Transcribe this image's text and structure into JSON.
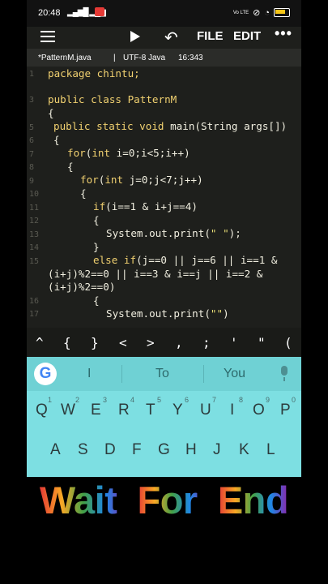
{
  "status": {
    "time": "20:48",
    "net_label": "Vo LTE"
  },
  "toolbar": {
    "file_label": "FILE",
    "edit_label": "EDIT",
    "more": "•••"
  },
  "tab": {
    "filename": "*PatternM.java",
    "sep1": "|",
    "encoding": "UTF-8",
    "language": "Java",
    "cursor": "16:343"
  },
  "editor": {
    "line_numbers": [
      "1",
      "3",
      "5",
      "6",
      "7",
      "8",
      "9",
      "10",
      "11",
      "12",
      "13",
      "14",
      "15",
      "16",
      "17"
    ],
    "lines": {
      "l1": "package chintu;",
      "l3a": "public",
      "l3b": " class PatternM",
      "l4": "{",
      "l5a": "public",
      "l5b": " static",
      "l5c": " void",
      "l5d": " main(String args[])",
      "l6": "{",
      "l7a": "for",
      "l7b": "(",
      "l7c": "int",
      "l7d": " i=0;i<5;i++)",
      "l8": "{",
      "l9a": "for",
      "l9b": "(",
      "l9c": "int",
      "l9d": " j=0;j<7;j++)",
      "l10": "{",
      "l11a": "if",
      "l11b": "(i==1 & i+j==4)",
      "l12": "{",
      "l13a": "System.out.print(",
      "l13b": "\" \"",
      "l13c": ");",
      "l14": "}",
      "l15a": "else if",
      "l15b": "(j==0 || j==6 || i==1 &",
      "l15w1": "(i+j)%2==0 || i==3 & i==j || i==2 &",
      "l15w2": "(i+j)%2==0)",
      "l16": "{",
      "l17a": "System.out.print(",
      "l17b": "\"\"",
      "l17c": ")"
    }
  },
  "symbols": [
    "^",
    "{",
    "}",
    "<",
    ">",
    ",",
    ";",
    "'",
    "\"",
    "("
  ],
  "suggestions": {
    "left": "I",
    "middle": "To",
    "right": "You"
  },
  "keyboard": {
    "row1": [
      "Q",
      "W",
      "E",
      "R",
      "T",
      "Y",
      "U",
      "I",
      "O",
      "P"
    ],
    "row1_hints": [
      "1",
      "2",
      "3",
      "4",
      "5",
      "6",
      "7",
      "8",
      "9",
      "0"
    ],
    "row2": [
      "A",
      "S",
      "D",
      "F",
      "G",
      "H",
      "J",
      "K",
      "L"
    ]
  },
  "banner": {
    "text_parts": [
      "Wait ",
      "For ",
      "End"
    ],
    "colors": [
      "#e53935",
      "#f9a825",
      "#43a047",
      "#1e88e5",
      "#8e24aa"
    ]
  }
}
